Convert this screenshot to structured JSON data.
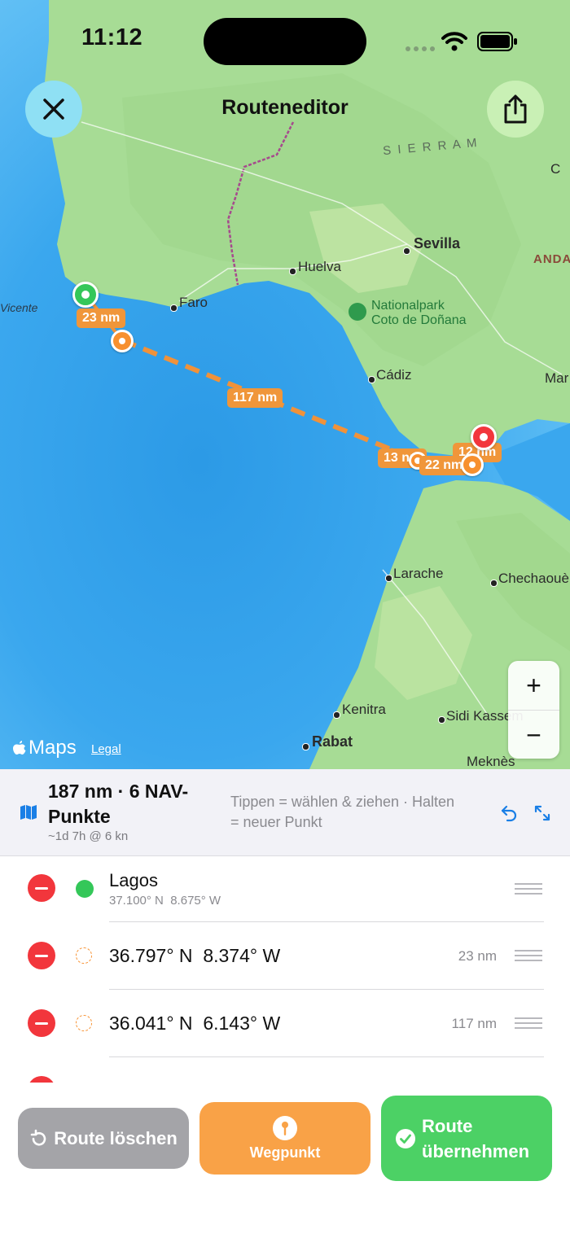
{
  "status": {
    "time": "11:12"
  },
  "nav": {
    "title": "Routeneditor",
    "close": "close",
    "share": "share"
  },
  "map": {
    "cities": {
      "sevilla": "Sevilla",
      "huelva": "Huelva",
      "faro": "Faro",
      "nationalpark": "Nationalpark\nCoto de Doñana",
      "cadiz": "Cádiz",
      "mar": "Mar",
      "larache": "Larache",
      "chechaouen": "Chechaouè",
      "kenitra": "Kenitra",
      "sidi": "Sidi Kassem",
      "rabat": "Rabat",
      "meknes": "Meknès",
      "vicente": "Vicente",
      "sierra": "S I E R R A   M",
      "anda": "ANDA",
      "c": "C"
    },
    "legs": [
      "23 nm",
      "117 nm",
      "13 nm",
      "22 nm",
      "12 nm"
    ],
    "brand": "Maps",
    "legal": "Legal"
  },
  "zoom": {
    "in": "+",
    "out": "−"
  },
  "summary": {
    "title": "187 nm · 6 NAV-Punkte",
    "title_line1": "187 nm · 6 NAV-",
    "title_line2": "Punkte",
    "eta": "~1d 7h @ 6 kn",
    "hint_line1": "Tippen = wählen & ziehen · Halten",
    "hint_line2": "= neuer Punkt"
  },
  "waypoints": [
    {
      "name": "Lagos",
      "coords": "37.100° N  8.675° W",
      "distance": ""
    },
    {
      "name": "36.797° N  8.374° W",
      "coords": "",
      "distance": "23 nm"
    },
    {
      "name": "36.041° N  6.143° W",
      "coords": "",
      "distance": "117 nm"
    }
  ],
  "actions": {
    "clear": "Route löschen",
    "waypoint": "Wegpunkt",
    "apply_line1": "Route",
    "apply_line2": "übernehmen"
  },
  "colors": {
    "accent_orange": "#f7902f",
    "route_green": "#34c759",
    "route_red": "#f2363c",
    "link_blue": "#1a7fe6",
    "clear_gray": "#a4a4a8",
    "apply_green": "#4cd165"
  }
}
